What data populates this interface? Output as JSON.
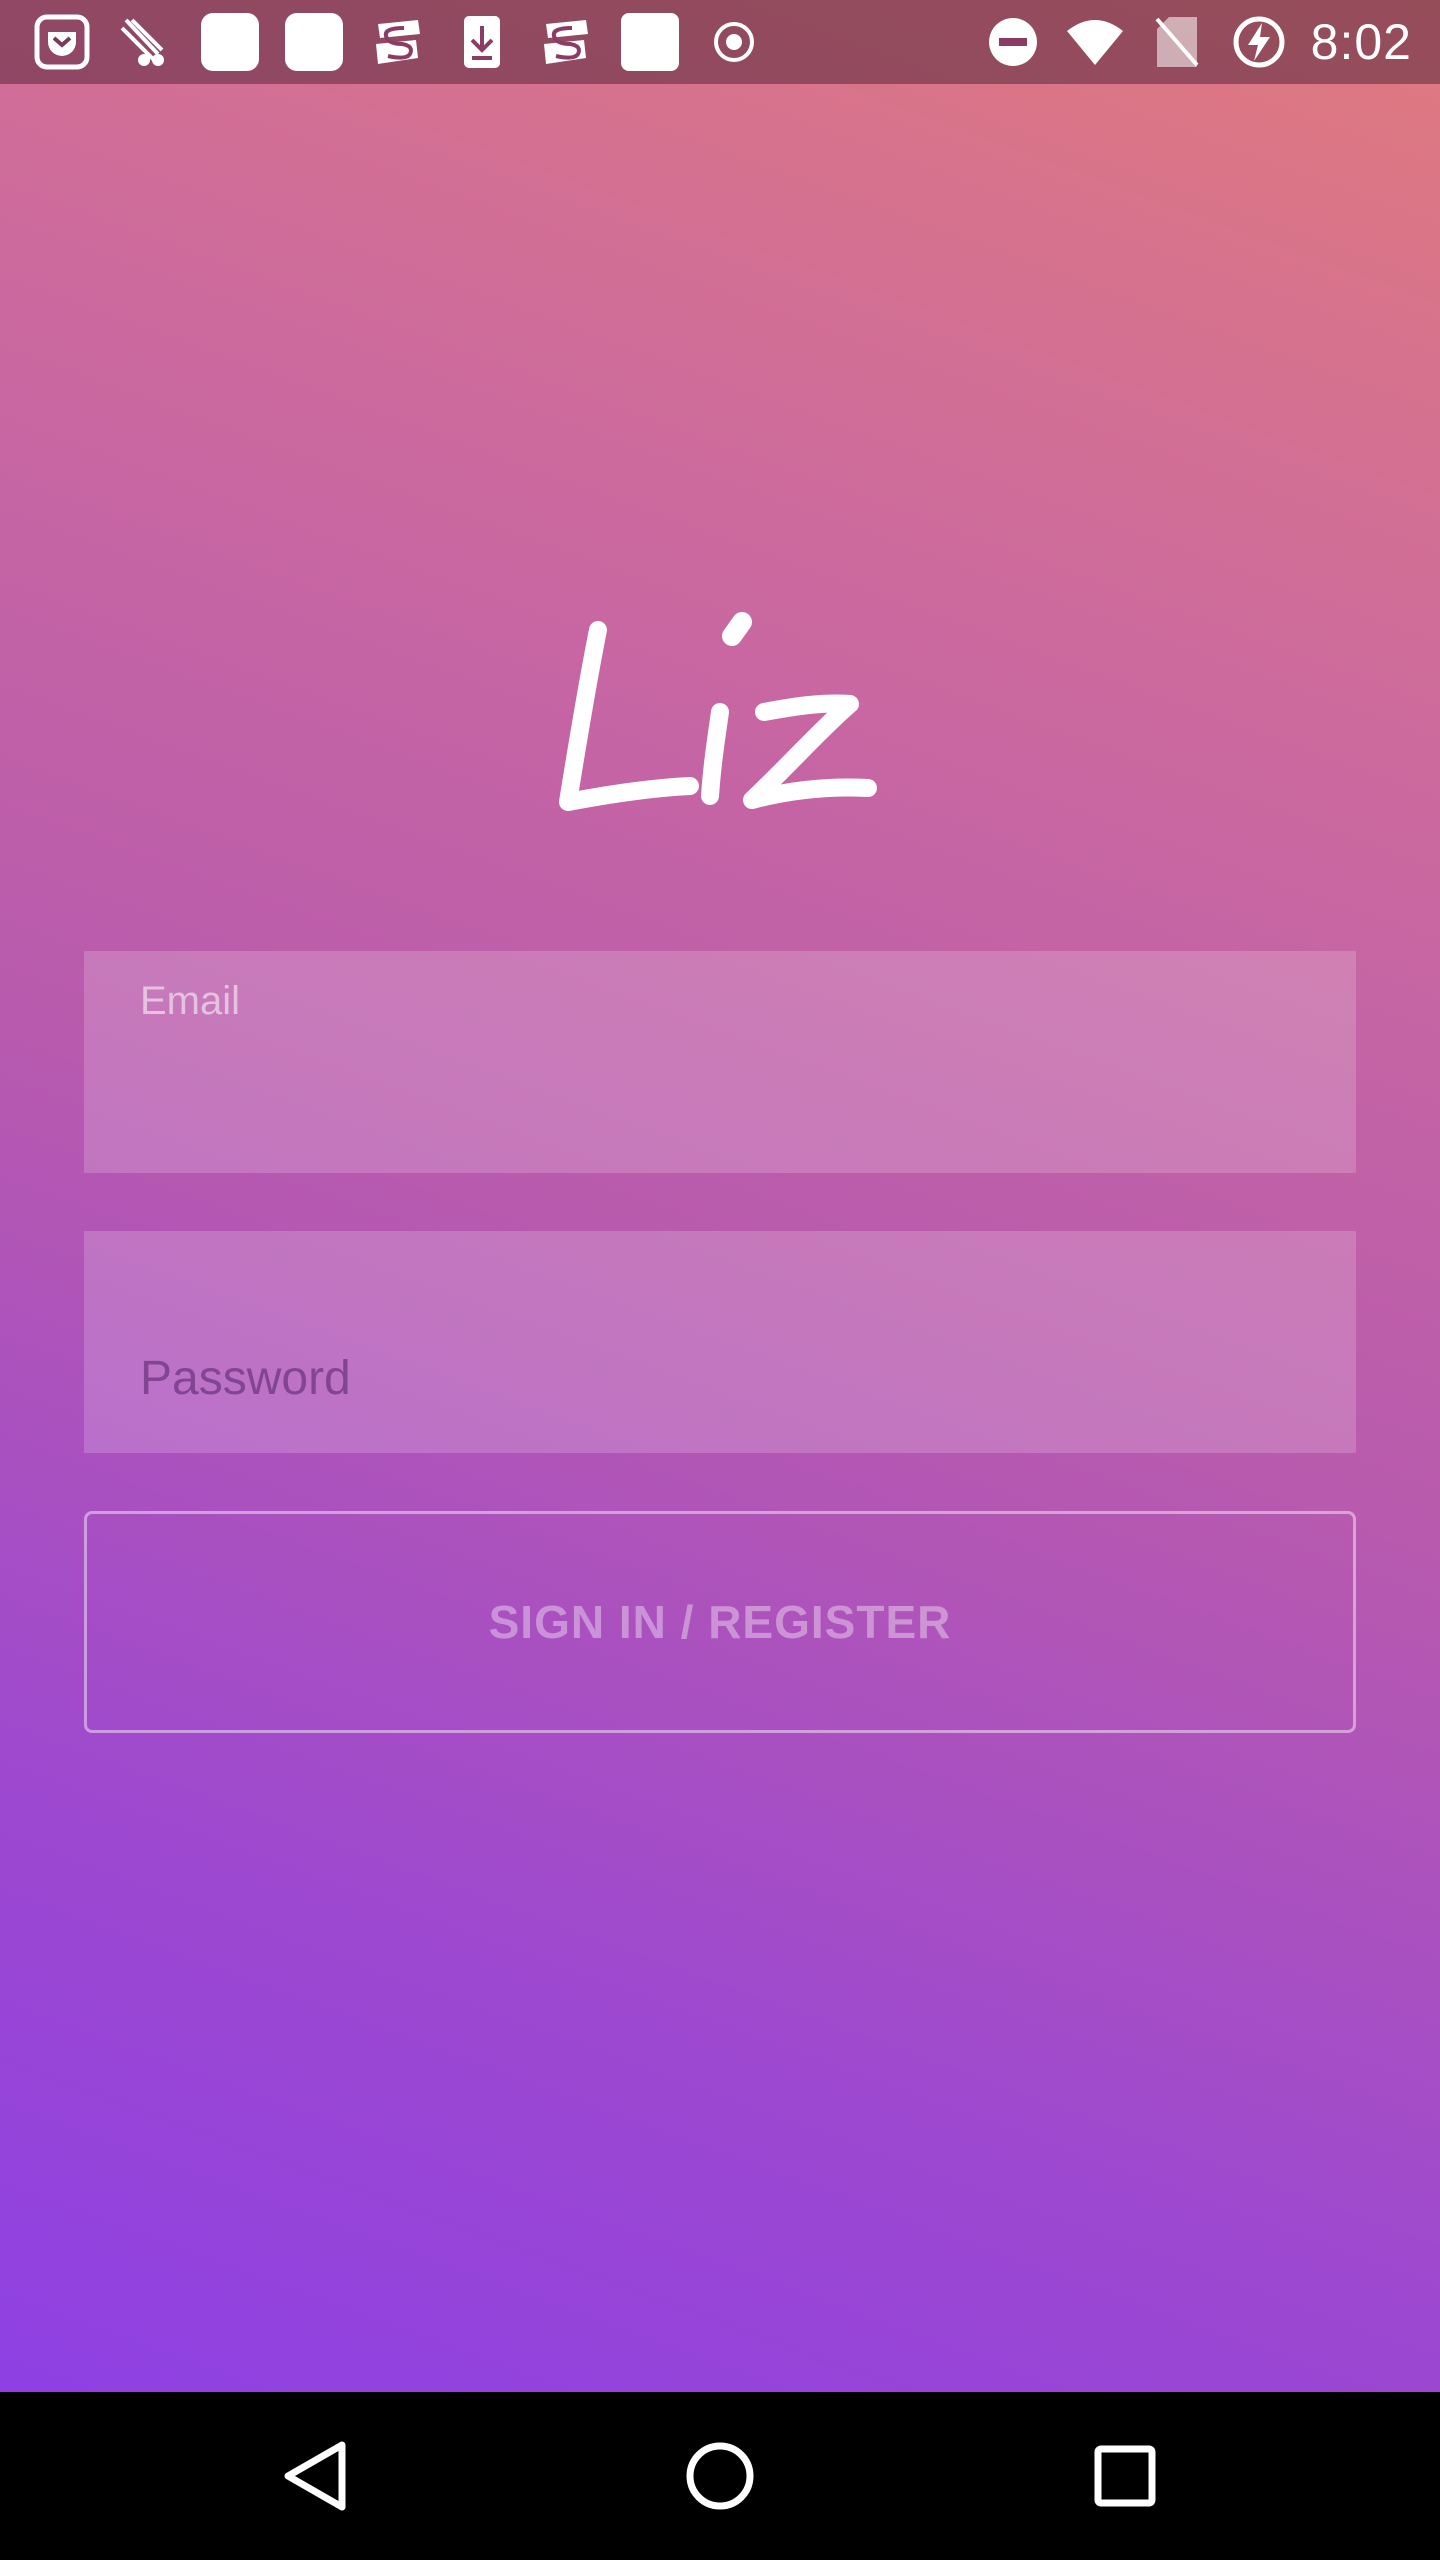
{
  "status_bar": {
    "time": "8:02",
    "left_icons": [
      "pocket-icon",
      "bird-notification-icon",
      "blank-app-icon",
      "blank-app-icon",
      "s-app-icon",
      "download-icon",
      "s-app-icon",
      "blank-app-icon",
      "record-icon"
    ],
    "right_icons": [
      "do-not-disturb-icon",
      "wifi-icon",
      "no-sim-icon",
      "battery-charging-icon"
    ]
  },
  "app": {
    "logo_text": "Liz"
  },
  "login_form": {
    "email_label": "Email",
    "email_value": "",
    "password_placeholder": "Password",
    "password_value": "",
    "submit_label": "SIGN IN / REGISTER"
  },
  "nav_bar": {
    "buttons": [
      "back-icon",
      "home-icon",
      "recents-icon"
    ]
  },
  "colors": {
    "gradient_top": "#e07a7e",
    "gradient_mid": "#b85aae",
    "gradient_bottom": "#8a3ee8",
    "nav_bar": "#000000"
  }
}
